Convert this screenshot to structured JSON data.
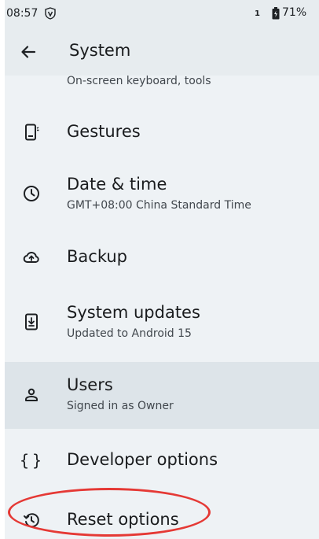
{
  "status_bar": {
    "time": "08:57",
    "sim_indicator": "1",
    "battery_percent": "71%",
    "icons": [
      "vpn-shield-icon",
      "battery-icon"
    ]
  },
  "app_bar": {
    "title": "System",
    "back_icon": "arrow-left-icon"
  },
  "list": {
    "partial_item_subtitle": "On-screen keyboard, tools",
    "items": [
      {
        "title": "Gestures",
        "subtitle": "",
        "icon": "phone-gesture-icon"
      },
      {
        "title": "Date & time",
        "subtitle": "GMT+08:00 China Standard Time",
        "icon": "clock-icon"
      },
      {
        "title": "Backup",
        "subtitle": "",
        "icon": "cloud-upload-icon"
      },
      {
        "title": "System updates",
        "subtitle": "Updated to Android 15",
        "icon": "system-update-icon"
      },
      {
        "title": "Users",
        "subtitle": "Signed in as Owner",
        "icon": "person-icon"
      },
      {
        "title": "Developer options",
        "subtitle": "",
        "icon": "code-braces-icon"
      },
      {
        "title": "Reset options",
        "subtitle": "",
        "icon": "history-icon"
      }
    ]
  },
  "colors": {
    "background": "#eef2f5",
    "bar": "#e7ecef",
    "highlight": "#dde4e9",
    "annotation": "#e53935"
  }
}
